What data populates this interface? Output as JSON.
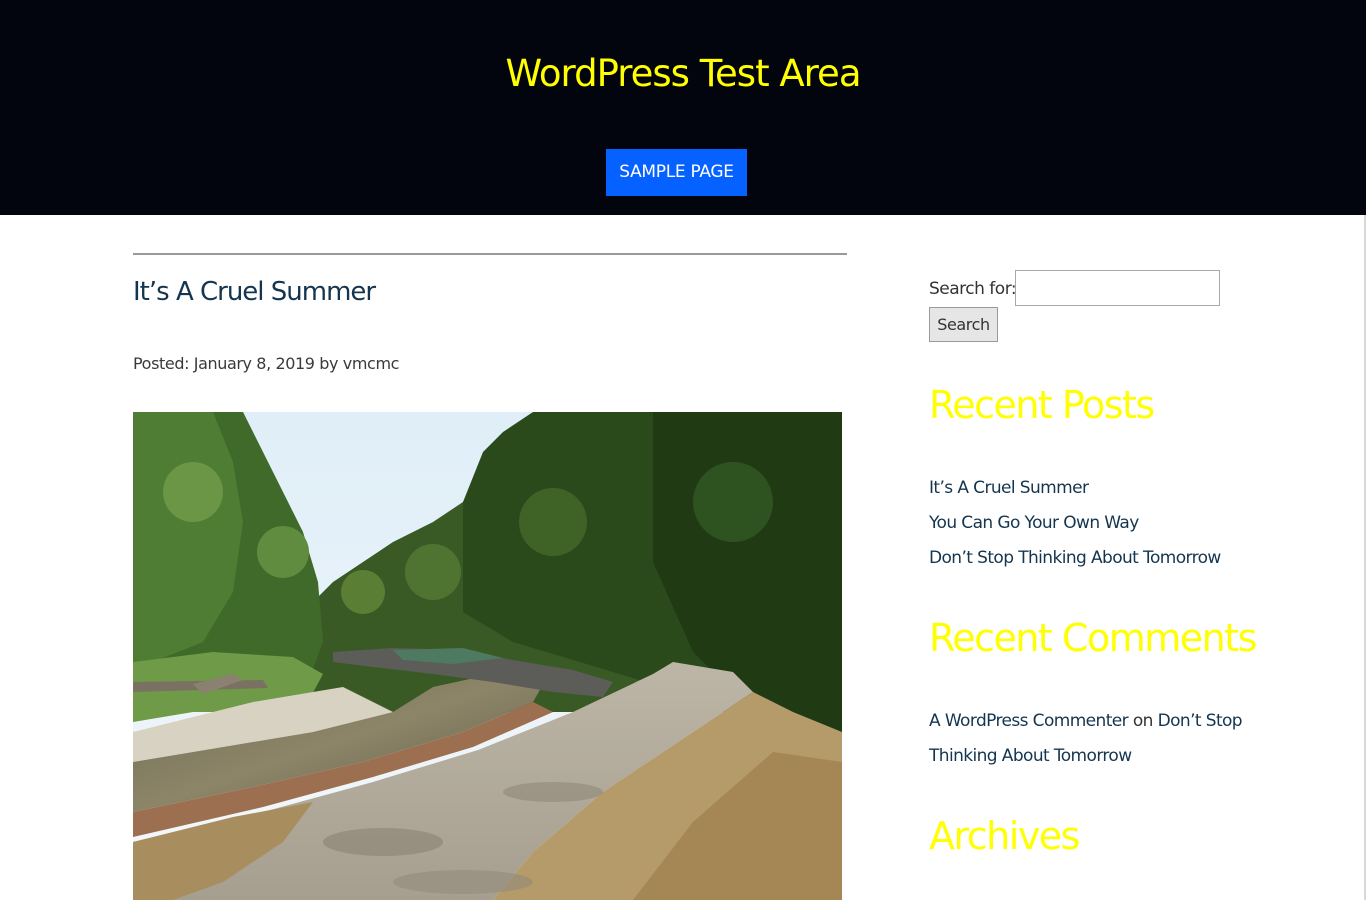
{
  "header": {
    "site_title": "WordPress Test Area",
    "nav": [
      {
        "label": "SAMPLE PAGE"
      }
    ]
  },
  "post": {
    "title": "It’s A Cruel Summer",
    "meta_prefix": "Posted: ",
    "date": "January 8, 2019",
    "by": " by ",
    "author": "vmcmc"
  },
  "sidebar": {
    "search": {
      "label": "Search for:",
      "value": "",
      "button": "Search"
    },
    "recent_posts": {
      "title": "Recent Posts",
      "items": [
        "It’s A Cruel Summer",
        "You Can Go Your Own Way",
        "Don’t Stop Thinking About Tomorrow"
      ]
    },
    "recent_comments": {
      "title": "Recent Comments",
      "author": "A WordPress Commenter",
      "on": " on ",
      "post_line1": "Don’t Stop",
      "post_line2": "Thinking About Tomorrow"
    },
    "archives": {
      "title": "Archives"
    }
  },
  "colors": {
    "header_bg": "#02050d",
    "site_title": "#ffff00",
    "nav_button": "#0561ff",
    "link": "#15354f",
    "widget_title": "#ffff00"
  }
}
